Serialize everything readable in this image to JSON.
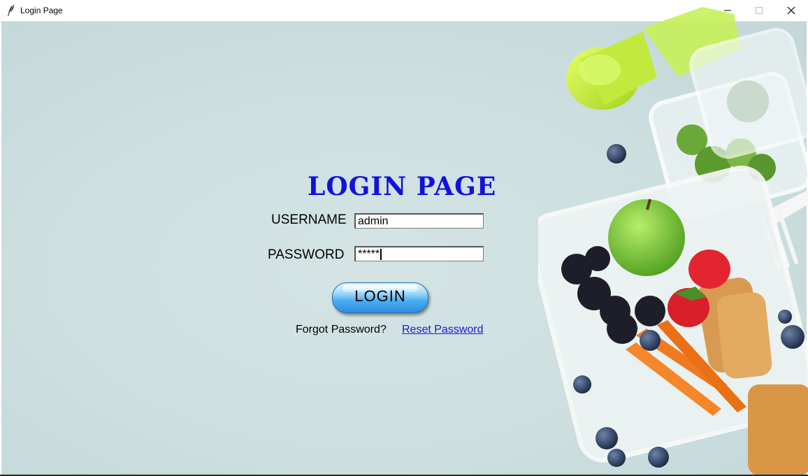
{
  "window": {
    "title": "Login Page"
  },
  "login": {
    "heading": "LOGIN PAGE",
    "username_label": "USERNAME",
    "username_value": "admin",
    "password_label": "PASSWORD",
    "password_value": "*****",
    "login_button": "LOGIN",
    "forgot_text": "Forgot Password?",
    "reset_link": "Reset Password"
  },
  "colors": {
    "heading": "#1111dd",
    "link": "#1a1ad8",
    "background": "#cddfdf",
    "button": "#49aef1"
  },
  "icons": [
    "feather-icon",
    "minimize-icon",
    "maximize-icon",
    "close-icon"
  ]
}
